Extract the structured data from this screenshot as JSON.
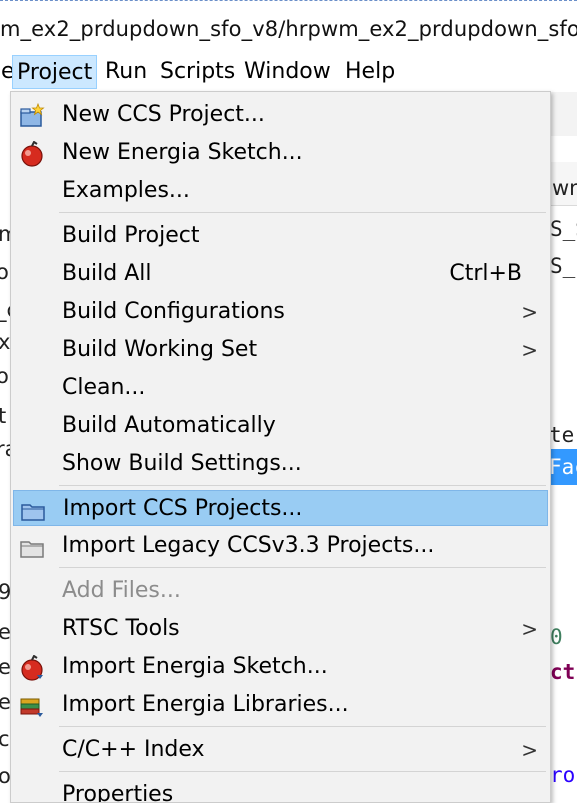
{
  "window": {
    "title": "m_ex2_prdupdown_sfo_v8/hrpwm_ex2_prdupdown_sfo"
  },
  "menubar": {
    "items": [
      {
        "label": "e"
      },
      {
        "label": "Project"
      },
      {
        "label": "Run"
      },
      {
        "label": "Scripts"
      },
      {
        "label": "Window"
      },
      {
        "label": "Help"
      }
    ]
  },
  "background": {
    "right_fragments": [
      "wn_",
      "S_S",
      "S_",
      "te",
      "Fac",
      "0 ",
      "ct",
      "ro"
    ],
    "left_fragments": [
      "m",
      "ou",
      "_c",
      "x",
      "ol",
      "t",
      "ra",
      "9",
      "e",
      "e",
      "e",
      "c",
      "o"
    ]
  },
  "menu": {
    "items": [
      {
        "label": "New CCS Project...",
        "icon": "new-project-icon"
      },
      {
        "label": "New Energia Sketch...",
        "icon": "energia-sketch-icon"
      },
      {
        "label": "Examples..."
      },
      {
        "label": "Build Project"
      },
      {
        "label": "Build All",
        "accelerator": "Ctrl+B"
      },
      {
        "label": "Build Configurations",
        "submenu": true
      },
      {
        "label": "Build Working Set",
        "submenu": true
      },
      {
        "label": "Clean..."
      },
      {
        "label": "Build Automatically"
      },
      {
        "label": "Show Build Settings..."
      },
      {
        "label": "Import CCS Projects...",
        "icon": "import-folder-icon",
        "highlighted": true
      },
      {
        "label": "Import Legacy CCSv3.3 Projects...",
        "icon": "import-legacy-folder-icon"
      },
      {
        "label": "Add Files...",
        "disabled": true
      },
      {
        "label": "RTSC Tools",
        "submenu": true
      },
      {
        "label": "Import Energia Sketch...",
        "icon": "energia-sketch-icon"
      },
      {
        "label": "Import Energia Libraries...",
        "icon": "library-books-icon"
      },
      {
        "label": "C/C++ Index",
        "submenu": true
      },
      {
        "label": "Properties"
      }
    ],
    "submenu_arrow": ">"
  },
  "colors": {
    "highlight": "#99ccf3",
    "menubar_active": "#cce8ff",
    "menu_bg": "#f2f2f2",
    "disabled_text": "#8c8c8c",
    "selection_blue": "#3399ff"
  }
}
